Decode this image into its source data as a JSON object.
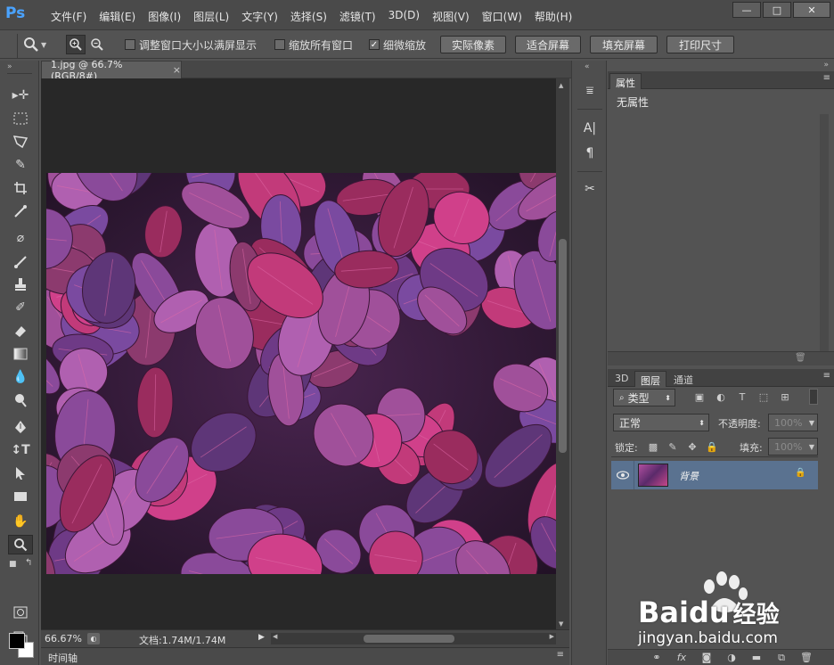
{
  "app": {
    "logo": "Ps"
  },
  "menu": [
    "文件(F)",
    "编辑(E)",
    "图像(I)",
    "图层(L)",
    "文字(Y)",
    "选择(S)",
    "滤镜(T)",
    "3D(D)",
    "视图(V)",
    "窗口(W)",
    "帮助(H)"
  ],
  "window_buttons": {
    "minimize": "—",
    "maximize": "□",
    "close": "✕"
  },
  "options": {
    "resize_windows": "调整窗口大小以满屏显示",
    "zoom_all_windows": "缩放所有窗口",
    "scrubby_zoom": "细微缩放",
    "actual_pixels": "实际像素",
    "fit_screen": "适合屏幕",
    "fill_screen": "填充屏幕",
    "print_size": "打印尺寸"
  },
  "document": {
    "tab_title": "1.jpg @ 66.7%(RGB/8#)",
    "tab_close": "×"
  },
  "status": {
    "zoom": "66.67%",
    "doc_info": "文档:1.74M/1.74M"
  },
  "timeline": {
    "label": "时间轴"
  },
  "properties": {
    "tab": "属性",
    "content": "无属性"
  },
  "layers_panel": {
    "tabs": [
      "3D",
      "图层",
      "通道"
    ],
    "filter_kind": "类型",
    "blend_mode": "正常",
    "opacity_label": "不透明度:",
    "opacity_value": "100%",
    "lock_label": "锁定:",
    "fill_label": "填充:",
    "fill_value": "100%",
    "layers": [
      {
        "name": "背景",
        "locked": true
      }
    ],
    "footer_fx": "fx"
  },
  "watermark": {
    "brand": "Bai",
    "brand2": "du",
    "cn": "经验",
    "url": "jingyan.baidu.com"
  },
  "colors": {
    "accent_blue": "#4aa3ff",
    "layer_selected": "#5a7290",
    "foreground": "#000000",
    "background": "#ffffff"
  }
}
